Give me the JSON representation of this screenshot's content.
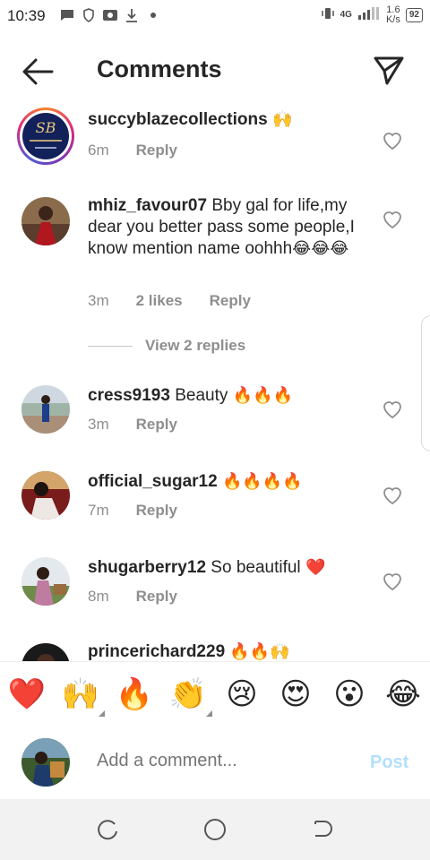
{
  "status_bar": {
    "time": "10:39",
    "network_type": "4G",
    "speed_value": "1.6",
    "speed_unit": "K/s",
    "battery": "92",
    "left_icons": [
      "message-icon",
      "shield-icon",
      "photo-icon",
      "download-icon",
      "dot-icon"
    ]
  },
  "header": {
    "title": "Comments"
  },
  "comments": [
    {
      "username": "succyblazecollections",
      "text": "",
      "emojis": "🙌",
      "time": "6m",
      "likes": "",
      "reply_label": "Reply"
    },
    {
      "username": "mhiz_favour07",
      "text": "Bby gal for life,my dear you better pass some people,I know mention name oohhh",
      "emojis": "😂😂😂",
      "time": "3m",
      "likes": "2 likes",
      "reply_label": "Reply",
      "view_replies": "View 2 replies"
    },
    {
      "username": "cress9193",
      "text": "Beauty",
      "emojis": "🔥🔥🔥",
      "time": "3m",
      "likes": "",
      "reply_label": "Reply"
    },
    {
      "username": "official_sugar12",
      "text": "",
      "emojis": "🔥🔥🔥🔥",
      "time": "7m",
      "likes": "",
      "reply_label": "Reply"
    },
    {
      "username": "shugarberry12",
      "text": "So beautiful",
      "emojis": "❤️",
      "time": "8m",
      "likes": "",
      "reply_label": "Reply"
    },
    {
      "username": "princerichard229",
      "text": "",
      "emojis": "🔥🔥🙌",
      "time": "",
      "likes": "",
      "reply_label": ""
    }
  ],
  "emoji_bar": [
    "❤️",
    "🙌",
    "🔥",
    "👏",
    "😢",
    "😍",
    "😮",
    "😂"
  ],
  "composer": {
    "placeholder": "Add a comment...",
    "post_label": "Post"
  },
  "colors": {
    "text": "#262626",
    "secondary": "#8e8e8e",
    "post_disabled": "#b2dffc",
    "story_ring": "#dd2a7b"
  }
}
